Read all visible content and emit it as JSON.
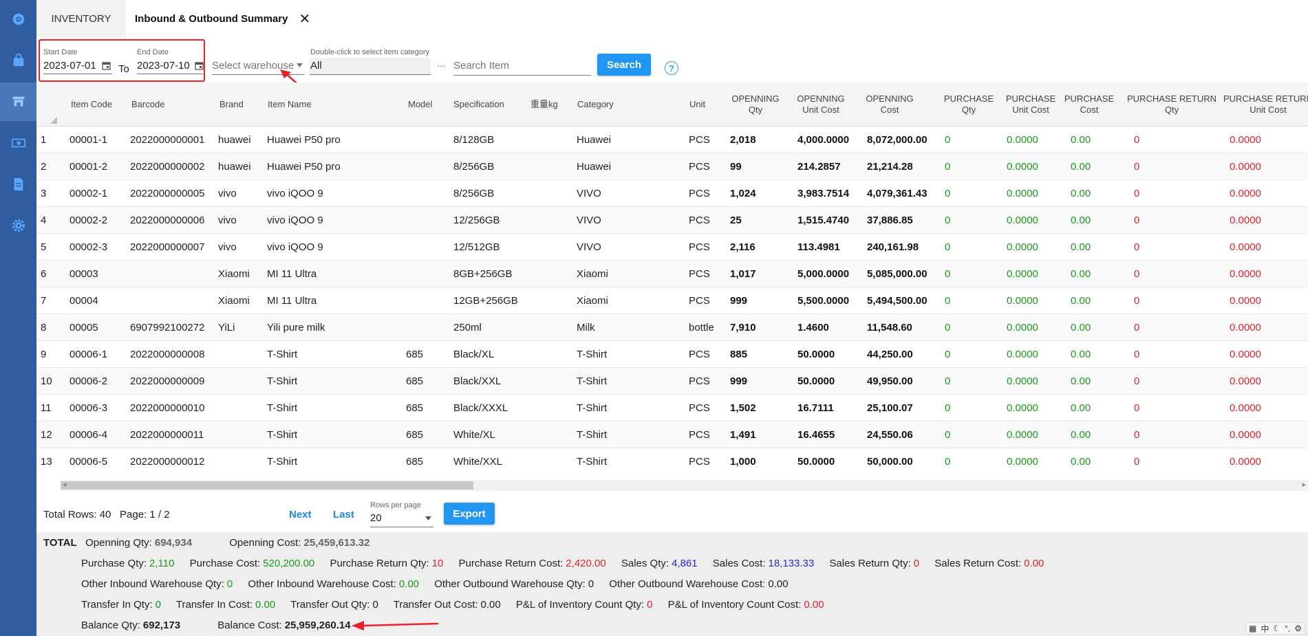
{
  "sidebar": {
    "icons": [
      "dashboard-gear-icon",
      "shopping-bag-icon",
      "store-icon",
      "money-icon",
      "document-icon",
      "settings-gear-icon"
    ]
  },
  "tabs": {
    "inventory": "INVENTORY",
    "summary": "Inbound & Outbound Summary",
    "close": "✕"
  },
  "filters": {
    "start_date_label": "Start Date",
    "start_date": "2023-07-01",
    "to": "To",
    "end_date_label": "End Date",
    "end_date": "2023-07-10",
    "warehouse_placeholder": "Select warehouse",
    "category_label": "Double-click to select item category",
    "category_value": "All",
    "ellipsis": "...",
    "search_placeholder": "Search Item",
    "search_button": "Search",
    "help": "?"
  },
  "table": {
    "headers": {
      "item_code": "Item Code",
      "barcode": "Barcode",
      "brand": "Brand",
      "item_name": "Item Name",
      "model": "Model",
      "specification": "Specification",
      "weight": "重量kg",
      "category": "Category",
      "unit": "Unit",
      "open_qty_1": "OPENNING",
      "open_qty_2": "Qty",
      "open_uc_1": "OPENNING",
      "open_uc_2": "Unit Cost",
      "open_cost_1": "OPENNING",
      "open_cost_2": "Cost",
      "pur_qty_1": "PURCHASE",
      "pur_qty_2": "Qty",
      "pur_uc_1": "PURCHASE",
      "pur_uc_2": "Unit Cost",
      "pur_cost_1": "PURCHASE",
      "pur_cost_2": "Cost",
      "pr_qty_1": "PURCHASE RETURN",
      "pr_qty_2": "Qty",
      "pr_uc_1": "PURCHASE RETURN",
      "pr_uc_2": "Unit Cost"
    },
    "rows": [
      {
        "no": "1",
        "code": "00001-1",
        "barcode": "2022000000001",
        "brand": "huawei",
        "name": "Huawei P50 pro",
        "model": "",
        "spec": "8/128GB",
        "category": "Huawei",
        "unit": "PCS",
        "oq": "2,018",
        "ouc": "4,000.0000",
        "oc": "8,072,000.00",
        "pq": "0",
        "puc": "0.0000",
        "pc": "0.00",
        "prq": "0",
        "pruc": "0.0000"
      },
      {
        "no": "2",
        "code": "00001-2",
        "barcode": "2022000000002",
        "brand": "huawei",
        "name": "Huawei P50 pro",
        "model": "",
        "spec": "8/256GB",
        "category": "Huawei",
        "unit": "PCS",
        "oq": "99",
        "ouc": "214.2857",
        "oc": "21,214.28",
        "pq": "0",
        "puc": "0.0000",
        "pc": "0.00",
        "prq": "0",
        "pruc": "0.0000"
      },
      {
        "no": "3",
        "code": "00002-1",
        "barcode": "2022000000005",
        "brand": "vivo",
        "name": "vivo iQOO 9",
        "model": "",
        "spec": "8/256GB",
        "category": "VIVO",
        "unit": "PCS",
        "oq": "1,024",
        "ouc": "3,983.7514",
        "oc": "4,079,361.43",
        "pq": "0",
        "puc": "0.0000",
        "pc": "0.00",
        "prq": "0",
        "pruc": "0.0000"
      },
      {
        "no": "4",
        "code": "00002-2",
        "barcode": "2022000000006",
        "brand": "vivo",
        "name": "vivo iQOO 9",
        "model": "",
        "spec": "12/256GB",
        "category": "VIVO",
        "unit": "PCS",
        "oq": "25",
        "ouc": "1,515.4740",
        "oc": "37,886.85",
        "pq": "0",
        "puc": "0.0000",
        "pc": "0.00",
        "prq": "0",
        "pruc": "0.0000"
      },
      {
        "no": "5",
        "code": "00002-3",
        "barcode": "2022000000007",
        "brand": "vivo",
        "name": "vivo iQOO 9",
        "model": "",
        "spec": "12/512GB",
        "category": "VIVO",
        "unit": "PCS",
        "oq": "2,116",
        "ouc": "113.4981",
        "oc": "240,161.98",
        "pq": "0",
        "puc": "0.0000",
        "pc": "0.00",
        "prq": "0",
        "pruc": "0.0000"
      },
      {
        "no": "6",
        "code": "00003",
        "barcode": "",
        "brand": "Xiaomi",
        "name": "MI 11 Ultra",
        "model": "",
        "spec": "8GB+256GB",
        "category": "Xiaomi",
        "unit": "PCS",
        "oq": "1,017",
        "ouc": "5,000.0000",
        "oc": "5,085,000.00",
        "pq": "0",
        "puc": "0.0000",
        "pc": "0.00",
        "prq": "0",
        "pruc": "0.0000"
      },
      {
        "no": "7",
        "code": "00004",
        "barcode": "",
        "brand": "Xiaomi",
        "name": "MI 11 Ultra",
        "model": "",
        "spec": "12GB+256GB",
        "category": "Xiaomi",
        "unit": "PCS",
        "oq": "999",
        "ouc": "5,500.0000",
        "oc": "5,494,500.00",
        "pq": "0",
        "puc": "0.0000",
        "pc": "0.00",
        "prq": "0",
        "pruc": "0.0000"
      },
      {
        "no": "8",
        "code": "00005",
        "barcode": "6907992100272",
        "brand": "YiLi",
        "name": "Yili pure milk",
        "model": "",
        "spec": "250ml",
        "category": "Milk",
        "unit": "bottle",
        "oq": "7,910",
        "ouc": "1.4600",
        "oc": "11,548.60",
        "pq": "0",
        "puc": "0.0000",
        "pc": "0.00",
        "prq": "0",
        "pruc": "0.0000"
      },
      {
        "no": "9",
        "code": "00006-1",
        "barcode": "2022000000008",
        "brand": "",
        "name": "T-Shirt",
        "model": "685",
        "spec": "Black/XL",
        "category": "T-Shirt",
        "unit": "PCS",
        "oq": "885",
        "ouc": "50.0000",
        "oc": "44,250.00",
        "pq": "0",
        "puc": "0.0000",
        "pc": "0.00",
        "prq": "0",
        "pruc": "0.0000"
      },
      {
        "no": "10",
        "code": "00006-2",
        "barcode": "2022000000009",
        "brand": "",
        "name": "T-Shirt",
        "model": "685",
        "spec": "Black/XXL",
        "category": "T-Shirt",
        "unit": "PCS",
        "oq": "999",
        "ouc": "50.0000",
        "oc": "49,950.00",
        "pq": "0",
        "puc": "0.0000",
        "pc": "0.00",
        "prq": "0",
        "pruc": "0.0000"
      },
      {
        "no": "11",
        "code": "00006-3",
        "barcode": "2022000000010",
        "brand": "",
        "name": "T-Shirt",
        "model": "685",
        "spec": "Black/XXXL",
        "category": "T-Shirt",
        "unit": "PCS",
        "oq": "1,502",
        "ouc": "16.7111",
        "oc": "25,100.07",
        "pq": "0",
        "puc": "0.0000",
        "pc": "0.00",
        "prq": "0",
        "pruc": "0.0000"
      },
      {
        "no": "12",
        "code": "00006-4",
        "barcode": "2022000000011",
        "brand": "",
        "name": "T-Shirt",
        "model": "685",
        "spec": "White/XL",
        "category": "T-Shirt",
        "unit": "PCS",
        "oq": "1,491",
        "ouc": "16.4655",
        "oc": "24,550.06",
        "pq": "0",
        "puc": "0.0000",
        "pc": "0.00",
        "prq": "0",
        "pruc": "0.0000"
      },
      {
        "no": "13",
        "code": "00006-5",
        "barcode": "2022000000012",
        "brand": "",
        "name": "T-Shirt",
        "model": "685",
        "spec": "White/XXL",
        "category": "T-Shirt",
        "unit": "PCS",
        "oq": "1,000",
        "ouc": "50.0000",
        "oc": "50,000.00",
        "pq": "0",
        "puc": "0.0000",
        "pc": "0.00",
        "prq": "0",
        "pruc": "0.0000"
      }
    ]
  },
  "pager": {
    "total_rows": "Total Rows: 40",
    "page": "Page: 1 / 2",
    "next": "Next",
    "last": "Last",
    "rows_per_page_label": "Rows per page",
    "rows_per_page": "20",
    "export": "Export"
  },
  "totals": {
    "title": "TOTAL",
    "opening_qty_label": "Openning Qty:",
    "opening_qty": "694,934",
    "opening_cost_label": "Openning Cost:",
    "opening_cost": "25,459,613.32",
    "purchase_qty_label": "Purchase Qty:",
    "purchase_qty": "2,110",
    "purchase_cost_label": "Purchase Cost:",
    "purchase_cost": "520,200.00",
    "pr_qty_label": "Purchase Return Qty:",
    "pr_qty": "10",
    "pr_cost_label": "Purchase Return Cost:",
    "pr_cost": "2,420.00",
    "sales_qty_label": "Sales Qty:",
    "sales_qty": "4,861",
    "sales_cost_label": "Sales Cost:",
    "sales_cost": "18,133.33",
    "sr_qty_label": "Sales Return Qty:",
    "sr_qty": "0",
    "sr_cost_label": "Sales Return Cost:",
    "sr_cost": "0.00",
    "oi_qty_label": "Other Inbound Warehouse Qty:",
    "oi_qty": "0",
    "oi_cost_label": "Other Inbound Warehouse Cost:",
    "oi_cost": "0.00",
    "oo_qty_label": "Other Outbound Warehouse Qty:",
    "oo_qty": "0",
    "oo_cost_label": "Other Outbound Warehouse Cost:",
    "oo_cost": "0.00",
    "ti_qty_label": "Transfer In Qty:",
    "ti_qty": "0",
    "ti_cost_label": "Transfer In Cost:",
    "ti_cost": "0.00",
    "to_qty_label": "Transfer Out Qty:",
    "to_qty": "0",
    "to_cost_label": "Transfer Out Cost:",
    "to_cost": "0.00",
    "pl_qty_label": "P&L of Inventory Count Qty:",
    "pl_qty": "0",
    "pl_cost_label": "P&L of Inventory Count Cost:",
    "pl_cost": "0.00",
    "bal_qty_label": "Balance Qty:",
    "bal_qty": "692,173",
    "bal_cost_label": "Balance Cost:",
    "bal_cost": "25,959,260.14"
  },
  "ime": {
    "mode": "中",
    "punct": "°,"
  },
  "colors": {
    "sidebar": "#2f5d9d",
    "accent": "#2196f3",
    "highlight_red": "#e8212b",
    "positive_green": "#1a9a1a",
    "negative_red": "#e0202a"
  }
}
